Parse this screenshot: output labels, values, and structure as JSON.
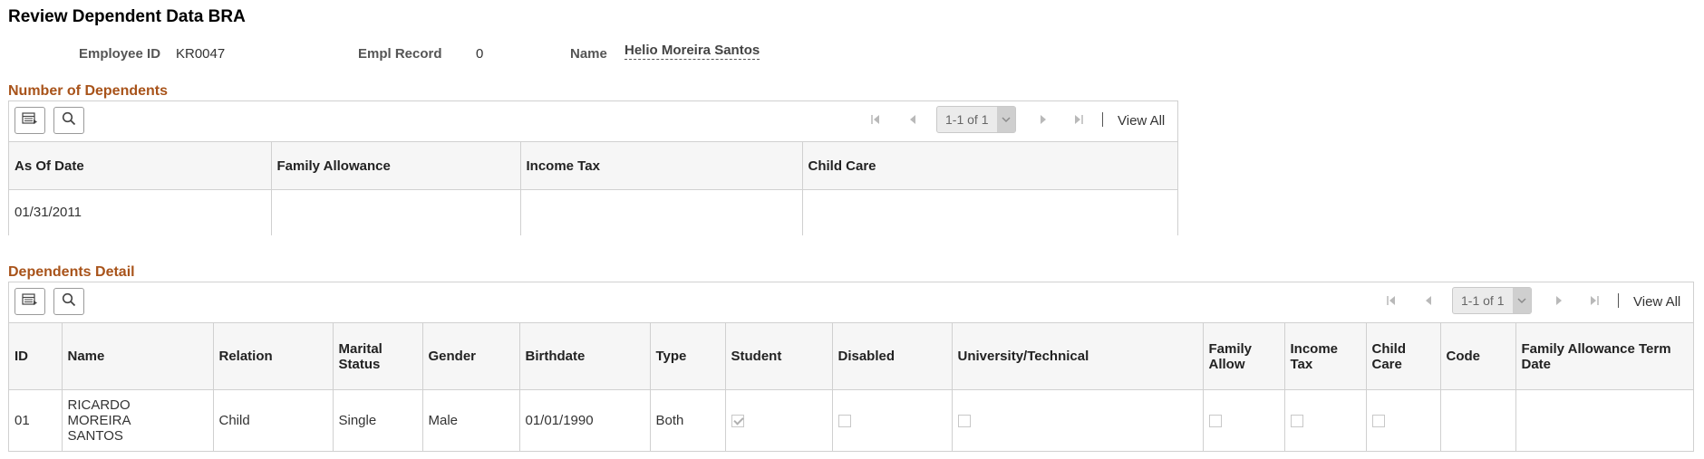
{
  "page": {
    "title": "Review Dependent Data BRA"
  },
  "employee": {
    "employee_id_label": "Employee ID",
    "employee_id": "KR0047",
    "empl_record_label": "Empl Record",
    "empl_record": "0",
    "name_label": "Name",
    "name": "Helio Moreira Santos"
  },
  "number_of_dependents": {
    "section_title": "Number of Dependents",
    "pagination": {
      "range": "1-1 of 1",
      "view_all": "View All"
    },
    "columns": [
      "As Of Date",
      "Family Allowance",
      "Income Tax",
      "Child Care"
    ],
    "rows": [
      {
        "as_of_date": "01/31/2011",
        "family_allowance": "",
        "income_tax": "",
        "child_care": ""
      }
    ]
  },
  "dependents_detail": {
    "section_title": "Dependents Detail",
    "pagination": {
      "range": "1-1 of 1",
      "view_all": "View All"
    },
    "columns": {
      "id": "ID",
      "name": "Name",
      "relation": "Relation",
      "marital_status_1": "Marital",
      "marital_status_2": "Status",
      "gender": "Gender",
      "birthdate": "Birthdate",
      "type": "Type",
      "student": "Student",
      "disabled": "Disabled",
      "university": "University/Technical",
      "family_allow_1": "Family",
      "family_allow_2": "Allow",
      "income_tax_1": "Income",
      "income_tax_2": "Tax",
      "child_care_1": "Child",
      "child_care_2": "Care",
      "code": "Code",
      "fa_term_1": "Family Allowance Term",
      "fa_term_2": "Date"
    },
    "rows": [
      {
        "id": "01",
        "name_1": "RICARDO",
        "name_2": "MOREIRA",
        "name_3": "SANTOS",
        "relation": "Child",
        "marital_status": "Single",
        "gender": "Male",
        "birthdate": "01/01/1990",
        "type": "Both",
        "student": true,
        "disabled": false,
        "university": false,
        "family_allow": false,
        "income_tax": false,
        "child_care": false,
        "code": "",
        "fa_term_date": ""
      }
    ]
  },
  "icons": {
    "personalize": "grid-personalize-icon",
    "find": "search-icon",
    "first": "first-page-icon",
    "prev": "previous-page-icon",
    "next": "next-page-icon",
    "last": "last-page-icon",
    "dropdown": "chevron-down-icon"
  },
  "colors": {
    "section_title": "#a8531a",
    "header_bg": "#f6f6f6",
    "border": "#d0d0d0"
  }
}
